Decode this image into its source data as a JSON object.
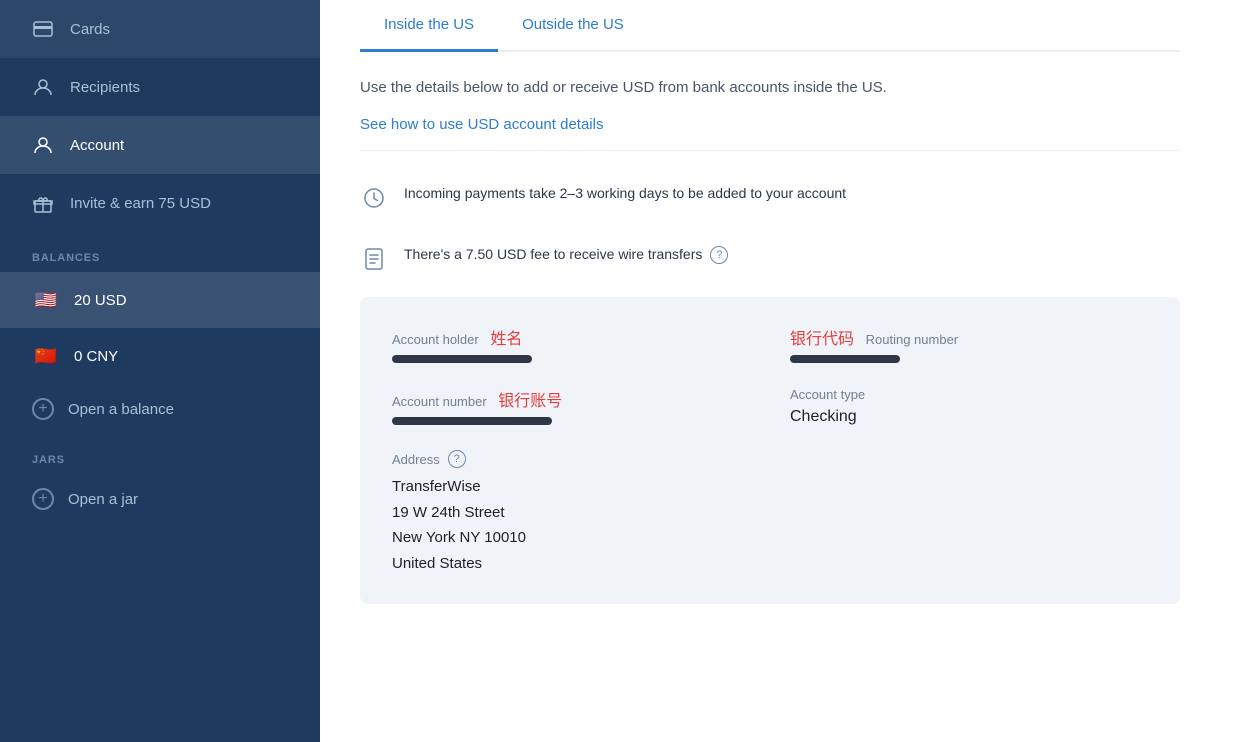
{
  "sidebar": {
    "nav_items": [
      {
        "id": "cards",
        "label": "Cards",
        "icon": "card"
      },
      {
        "id": "recipients",
        "label": "Recipients",
        "icon": "person"
      },
      {
        "id": "account",
        "label": "Account",
        "icon": "person",
        "active": true
      },
      {
        "id": "invite",
        "label": "Invite & earn 75 USD",
        "icon": "gift"
      }
    ],
    "balances_label": "Balances",
    "balances": [
      {
        "id": "usd",
        "currency": "20 USD",
        "flag": "🇺🇸",
        "active": true
      },
      {
        "id": "cny",
        "currency": "0 CNY",
        "flag": "🇨🇳",
        "active": false
      }
    ],
    "open_balance_label": "Open a balance",
    "jars_label": "Jars",
    "open_jar_label": "Open a jar"
  },
  "main": {
    "tabs": [
      {
        "id": "inside-us",
        "label": "Inside the US",
        "active": true
      },
      {
        "id": "outside-us",
        "label": "Outside the US",
        "active": false
      }
    ],
    "description": "Use the details below to add or receive USD from bank accounts inside the US.",
    "link_label": "See how to use USD account details",
    "info_items": [
      {
        "id": "working-days",
        "text": "Incoming payments take 2–3 working days to be added to your account",
        "icon": "clock"
      },
      {
        "id": "wire-fee",
        "text": "There's a 7.50 USD fee to receive wire transfers",
        "icon": "doc",
        "has_help": true
      }
    ],
    "account_details": {
      "account_holder_label": "Account holder",
      "account_holder_annotation": "姓名",
      "account_holder_redacted_width": 140,
      "routing_number_label": "Routing number",
      "routing_number_annotation": "银行代码",
      "routing_number_redacted_width": 110,
      "account_number_label": "Account number",
      "account_number_annotation": "银行账号",
      "account_number_redacted_width": 160,
      "account_type_label": "Account type",
      "account_type_value": "Checking",
      "address_label": "Address",
      "address_line1": "TransferWise",
      "address_line2": "19 W 24th Street",
      "address_line3": "New York NY 10010",
      "address_line4": "United States"
    }
  }
}
